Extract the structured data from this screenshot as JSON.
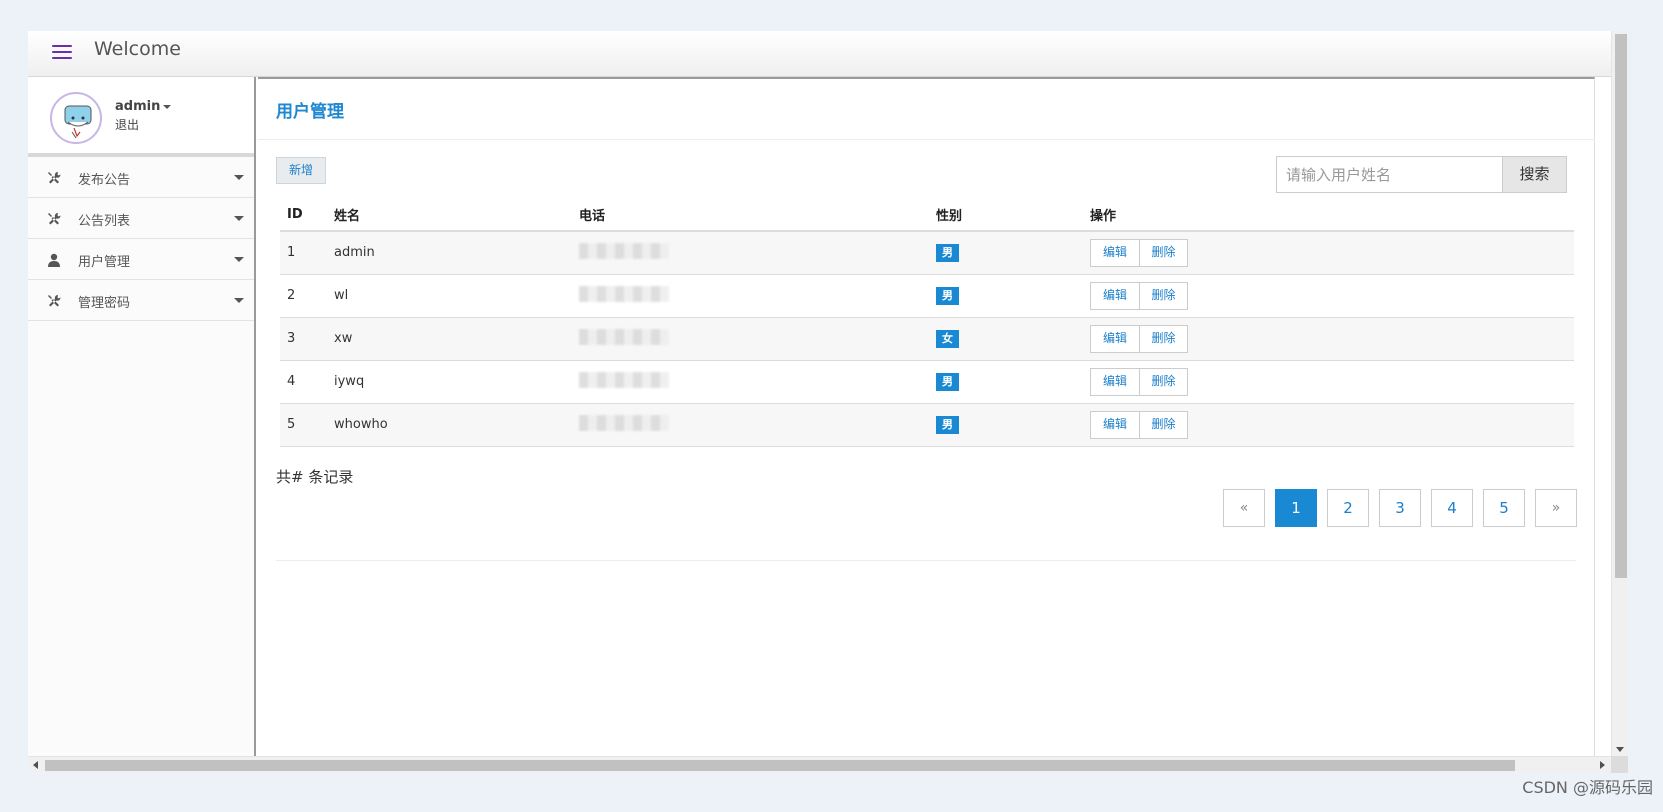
{
  "header": {
    "title": "Welcome",
    "menu_icon": "hamburger-icon"
  },
  "user": {
    "name": "admin",
    "logout": "退出",
    "avatar_icon": "cartoon-avatar"
  },
  "sidebar": {
    "items": [
      {
        "label": "发布公告",
        "icon": "wrench-icon"
      },
      {
        "label": "公告列表",
        "icon": "wrench-icon"
      },
      {
        "label": "用户管理",
        "icon": "user-icon"
      },
      {
        "label": "管理密码",
        "icon": "wrench-icon"
      }
    ]
  },
  "main": {
    "title": "用户管理",
    "add_label": "新增",
    "search": {
      "placeholder": "请输入用户姓名",
      "button": "搜索"
    },
    "table": {
      "headers": [
        "ID",
        "姓名",
        "电话",
        "性别",
        "操作"
      ],
      "rows": [
        {
          "id": "1",
          "name": "admin",
          "gender": "男"
        },
        {
          "id": "2",
          "name": "wl",
          "gender": "男"
        },
        {
          "id": "3",
          "name": "xw",
          "gender": "女"
        },
        {
          "id": "4",
          "name": "iywq",
          "gender": "男"
        },
        {
          "id": "5",
          "name": "whowho",
          "gender": "男"
        }
      ],
      "edit_label": "编辑",
      "delete_label": "删除"
    },
    "record_count": "共# 条记录",
    "pagination": {
      "prev": "«",
      "pages": [
        "1",
        "2",
        "3",
        "4",
        "5"
      ],
      "next": "»",
      "current": "1"
    }
  },
  "colors": {
    "accent": "#1989d3",
    "menu_icon": "#6b2fa6"
  },
  "watermark": "CSDN @源码乐园"
}
